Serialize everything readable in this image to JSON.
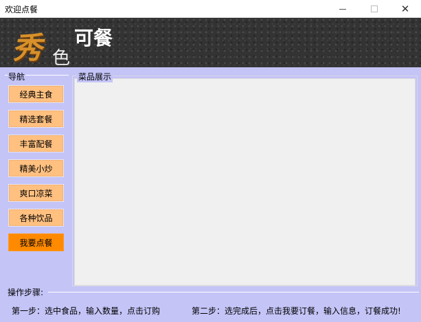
{
  "window": {
    "title": "欢迎点餐",
    "minimize_icon": "minimize-icon",
    "maximize_icon": "maximize-icon",
    "close_icon": "close-icon",
    "close_glyph": "✕"
  },
  "banner": {
    "logo_chars": [
      "秀",
      "色",
      "可餐"
    ]
  },
  "nav": {
    "label": "导航",
    "items": [
      {
        "label": "经典主食"
      },
      {
        "label": "精选套餐"
      },
      {
        "label": "丰富配餐"
      },
      {
        "label": "精美小炒"
      },
      {
        "label": "爽口凉菜"
      },
      {
        "label": "各种饮品"
      },
      {
        "label": "我要点餐"
      }
    ]
  },
  "dishes": {
    "label": "菜品展示"
  },
  "steps": {
    "label": "操作步骤:",
    "step1": "第一步：选中食品，输入数量，点击订购",
    "step2": "第二步：选完成后，点击我要订餐，输入信息，订餐成功!"
  },
  "colors": {
    "client_bg": "#c4c4f7",
    "nav_button": "#ffc080",
    "order_button": "#ff8a00",
    "logo_orange": "#d7912b"
  }
}
